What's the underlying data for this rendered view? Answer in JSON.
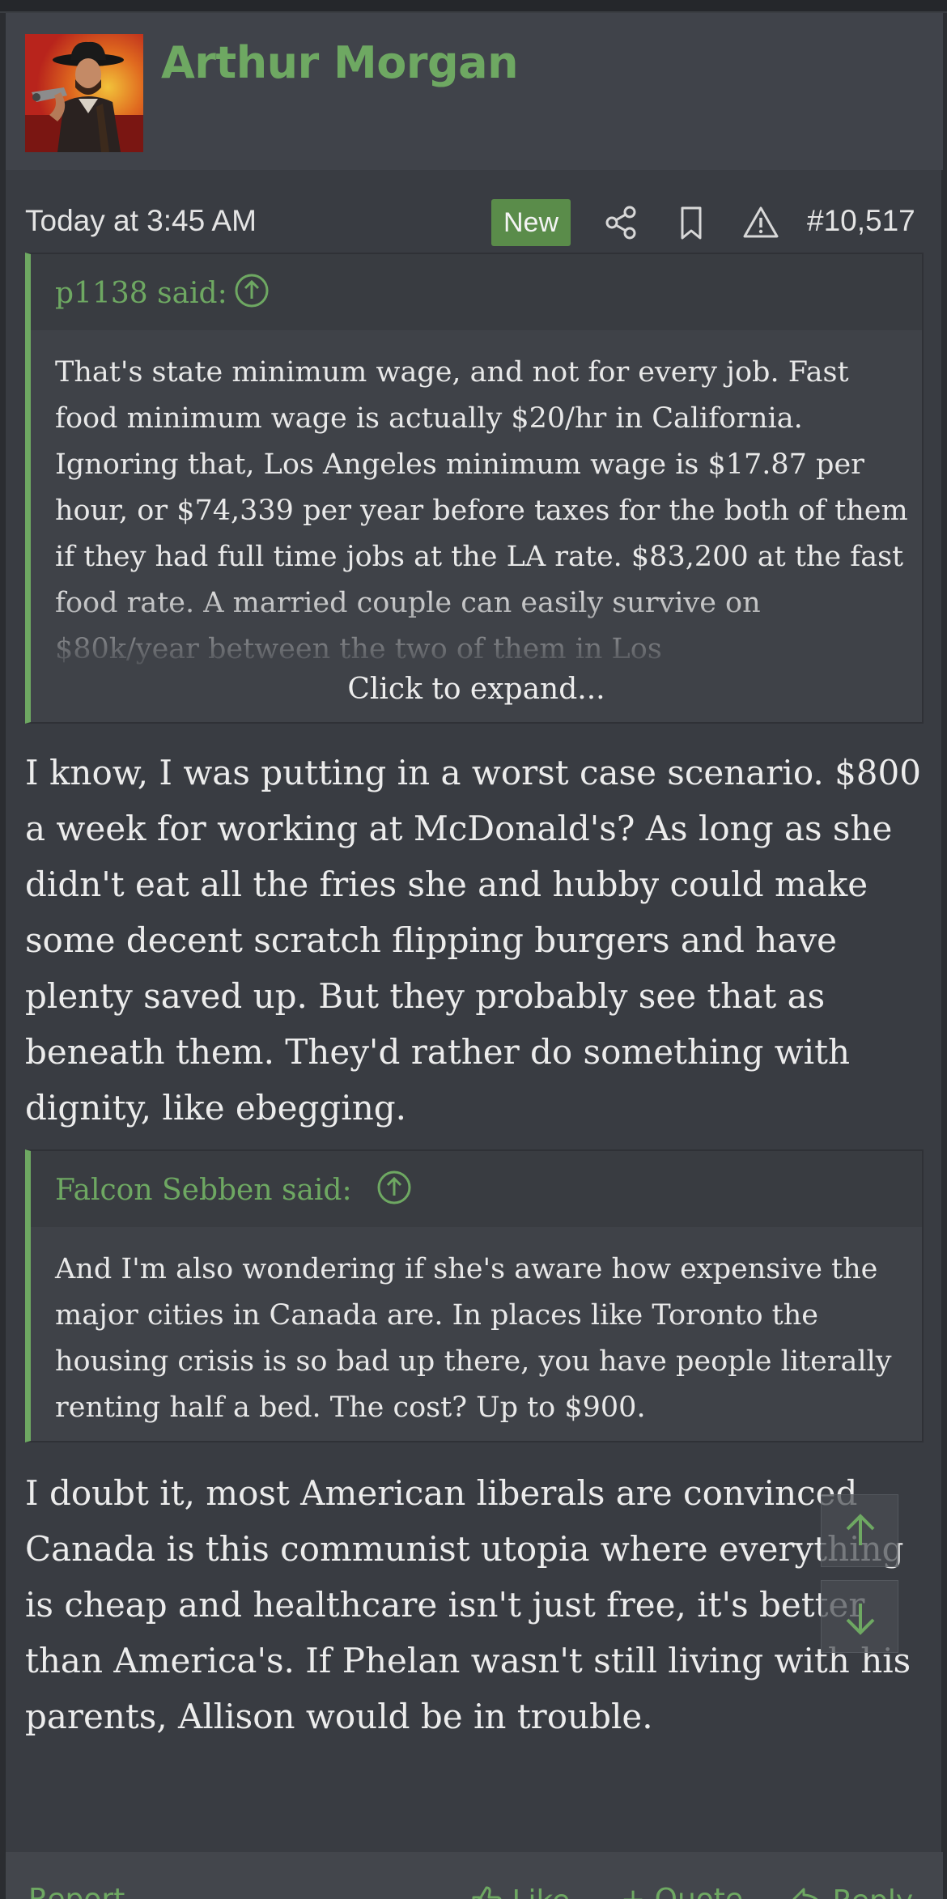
{
  "post": {
    "username": "Arthur Morgan",
    "date": "Today at 3:45 AM",
    "badge": "New",
    "post_number": "#10,517"
  },
  "quote1": {
    "attribution": "p1138 said:",
    "text": "That's state minimum wage, and not for every job. Fast food minimum wage is actually $20/hr in California. Ignoring that, Los Angeles minimum wage is $17.87 per hour, or $74,339 per year before taxes for the both of them if they had full time jobs at the LA rate. $83,200 at the fast food rate. A married couple can easily survive on $80k/year between the two of them in Los",
    "expand_label": "Click to expand..."
  },
  "message1": "I know, I was putting in a worst case scenario. $800 a week for working at McDonald's? As long as she didn't eat all the fries she and hubby could make some decent scratch flipping burgers and have plenty saved up. But they probably see that as beneath them. They'd rather do something with dignity, like ebegging.",
  "quote2": {
    "attribution": "Falcon Sebben said:",
    "text": "And I'm also wondering if she's aware how expensive the major cities in Canada are. In places like Toronto the housing crisis is so bad up there, you have people literally renting half a bed. The cost? Up to $900."
  },
  "message2": "I doubt it, most American liberals are convinced Canada is this communist utopia where everything is cheap and healthcare isn't just free, it's better than America's. If Phelan wasn't still living with his parents, Allison would be in trouble.",
  "footer": {
    "report": "Report",
    "like": "Like",
    "quote": "+ Quote",
    "reply": "Reply"
  },
  "icons": {
    "share": "share-icon",
    "bookmark": "bookmark-icon",
    "report": "warning-icon",
    "quote_jump": "arrow-up-circle-icon",
    "scroll_top": "arrow-up-icon",
    "scroll_bottom": "arrow-down-icon"
  },
  "colors": {
    "accent": "#6ea862",
    "badge": "#5a8c4a",
    "background": "#393c42",
    "header": "#40434a"
  }
}
